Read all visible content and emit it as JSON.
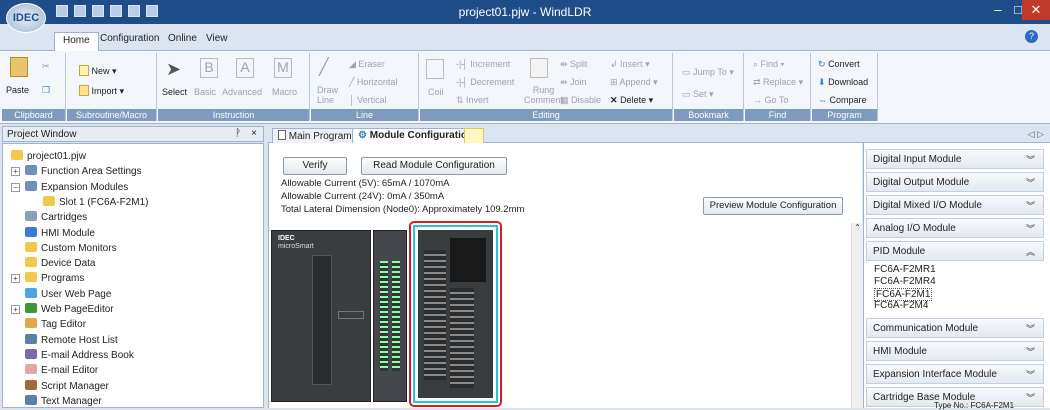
{
  "window": {
    "title": "project01.pjw - WindLDR",
    "minimize": "–",
    "maximize": "□",
    "close": "✕"
  },
  "app_button": "IDEC",
  "ribbon_tabs": [
    "Home",
    "Configuration",
    "Online",
    "View"
  ],
  "help_icon": "?",
  "ribbon": {
    "clipboard": {
      "paste": "Paste",
      "label": "Clipboard"
    },
    "subroutine": {
      "new": "New",
      "import": "Import",
      "label": "Subroutine/Macro"
    },
    "instruction": {
      "select": "Select",
      "basic": "Basic",
      "advanced": "Advanced",
      "macro": "Macro",
      "label": "Instruction"
    },
    "line": {
      "draw_line": "Draw\nLine",
      "eraser": "Eraser",
      "horizontal": "Horizontal",
      "vertical": "Vertical",
      "label": "Line"
    },
    "editing": {
      "coil": "Coil",
      "increment": "Increment",
      "decrement": "Decrement",
      "invert": "Invert",
      "rung_comment": "Rung\nComment",
      "split": "Split",
      "join": "Join",
      "disable": "Disable",
      "insert": "Insert",
      "append": "Append",
      "delete": "Delete",
      "label": "Editing"
    },
    "bookmark": {
      "jump_to": "Jump To",
      "set": "Set",
      "label": "Bookmark"
    },
    "find": {
      "find": "Find",
      "replace": "Replace",
      "goto": "Go To",
      "label": "Find"
    },
    "program": {
      "convert": "Convert",
      "download": "Download",
      "compare": "Compare",
      "label": "Program"
    }
  },
  "project_window": {
    "title": "Project Window",
    "pin": "ᚹ",
    "close": "×",
    "tree": [
      "project01.pjw",
      "Function Area Settings",
      "Expansion Modules",
      "Slot 1 (FC6A-F2M1)",
      "Cartridges",
      "HMI Module",
      "Custom Monitors",
      "Device Data",
      "Programs",
      "User Web Page",
      "Web PageEditor",
      "Tag Editor",
      "Remote Host List",
      "E-mail Address Book",
      "E-mail Editor",
      "Script Manager",
      "Text Manager"
    ]
  },
  "doc_tabs": [
    "Main Program",
    "Module Configuration"
  ],
  "tab_scroll": "◁ ▷",
  "module_config": {
    "verify": "Verify",
    "read": "Read Module Configuration",
    "current_5v": "Allowable Current (5V): 65mA / 1070mA",
    "current_24v": "Allowable Current (24V): 0mA / 350mA",
    "lateral": "Total Lateral Dimension (Node0): Approximately 109.2mm",
    "preview": "Preview Module Configuration",
    "cpu_brand": "IDEC",
    "cpu_model": "microSmart"
  },
  "categories": [
    "Digital Input Module",
    "Digital Output Module",
    "Digital Mixed I/O Module",
    "Analog I/O Module",
    "PID Module",
    "Communication Module",
    "HMI Module",
    "Expansion Interface Module",
    "Cartridge Base Module"
  ],
  "pid_items": [
    "FC6A-F2MR1",
    "FC6A-F2MR4",
    "FC6A-F2M1",
    "FC6A-F2M4"
  ],
  "type_no": "Type No.: FC6A-F2M1",
  "colors": {
    "highlight": "#e0191d",
    "selected": "#20c8d8",
    "title_bar": "#1f4d8a"
  }
}
